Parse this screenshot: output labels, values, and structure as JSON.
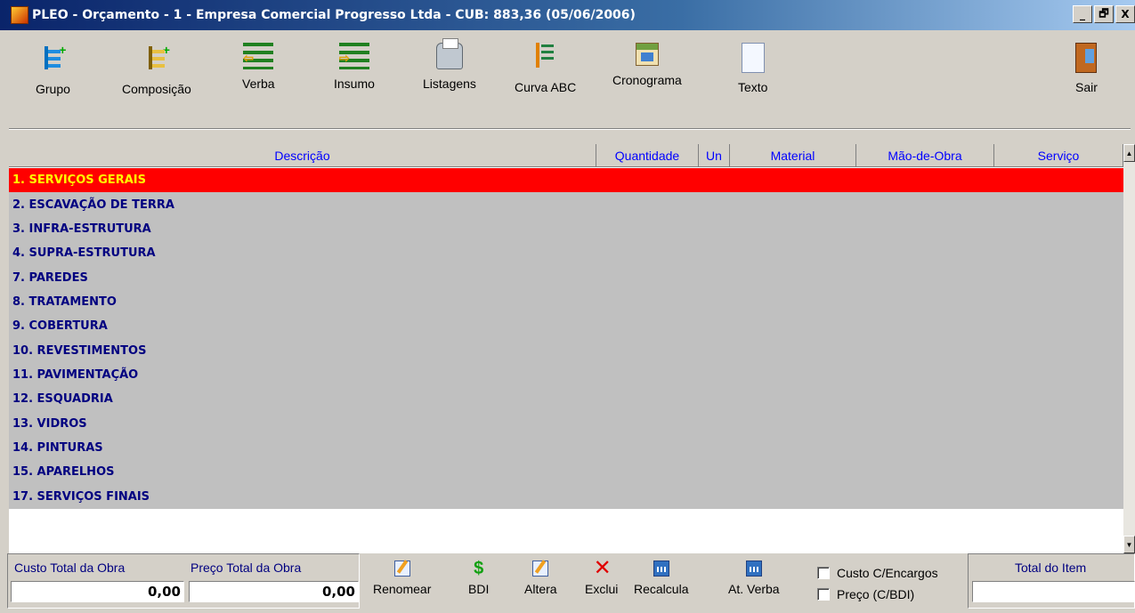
{
  "window": {
    "title": "PLEO - Orçamento - 1 - Empresa Comercial Progresso Ltda - CUB: 883,36 (05/06/2006)",
    "controls": [
      "_",
      "🗗",
      "X"
    ]
  },
  "toolbar": {
    "buttons": [
      {
        "label": "Grupo",
        "icon": "group-tree-icon"
      },
      {
        "label": "Composição",
        "icon": "composition-tree-icon"
      },
      {
        "label": "Verba",
        "icon": "verba-list-icon"
      },
      {
        "label": "Insumo",
        "icon": "insumo-list-icon"
      },
      {
        "label": "Listagens",
        "icon": "printer-icon"
      },
      {
        "label": "Curva ABC",
        "icon": "abc-curve-icon"
      },
      {
        "label": "Cronograma",
        "icon": "calendar-icon"
      },
      {
        "label": "Texto",
        "icon": "document-icon"
      },
      {
        "label": "Sair",
        "icon": "exit-door-icon"
      }
    ]
  },
  "grid": {
    "columns": [
      "Descrição",
      "Quantidade",
      "Un",
      "Material",
      "Mão-de-Obra",
      "Serviço"
    ],
    "rows": [
      "1. SERVIÇOS GERAIS",
      "2. ESCAVAÇÃO DE TERRA",
      "3. INFRA-ESTRUTURA",
      "4. SUPRA-ESTRUTURA",
      "7. PAREDES",
      "8. TRATAMENTO",
      "9. COBERTURA",
      "10. REVESTIMENTOS",
      "11. PAVIMENTAÇÃO",
      "12. ESQUADRIA",
      "13. VIDROS",
      "14. PINTURAS",
      "15. APARELHOS",
      "17. SERVIÇOS FINAIS"
    ],
    "selected_index": 0,
    "colors": {
      "selected_bg": "#ff0000",
      "selected_text": "#ffff00",
      "row_text": "#000080",
      "row_bg": "#c0c0c0"
    }
  },
  "totals": {
    "custo_label": "Custo Total da Obra",
    "custo_value": "0,00",
    "preco_label": "Preço Total da Obra",
    "preco_value": "0,00"
  },
  "actions": [
    {
      "label": "Renomear",
      "icon": "pencil-icon"
    },
    {
      "label": "BDI",
      "icon": "dollar-icon"
    },
    {
      "label": "Altera",
      "icon": "edit-icon"
    },
    {
      "label": "Exclui",
      "icon": "delete-x-icon"
    },
    {
      "label": "Recalcula",
      "icon": "calculator-icon"
    },
    {
      "label": "At. Verba",
      "icon": "calculator-icon"
    }
  ],
  "options": {
    "custo_encargos": {
      "label": "Custo C/Encargos",
      "checked": false
    },
    "preco_bdi": {
      "label": "Preço (C/BDI)",
      "checked": false
    }
  },
  "item_total": {
    "label": "Total do Item",
    "value": ""
  }
}
